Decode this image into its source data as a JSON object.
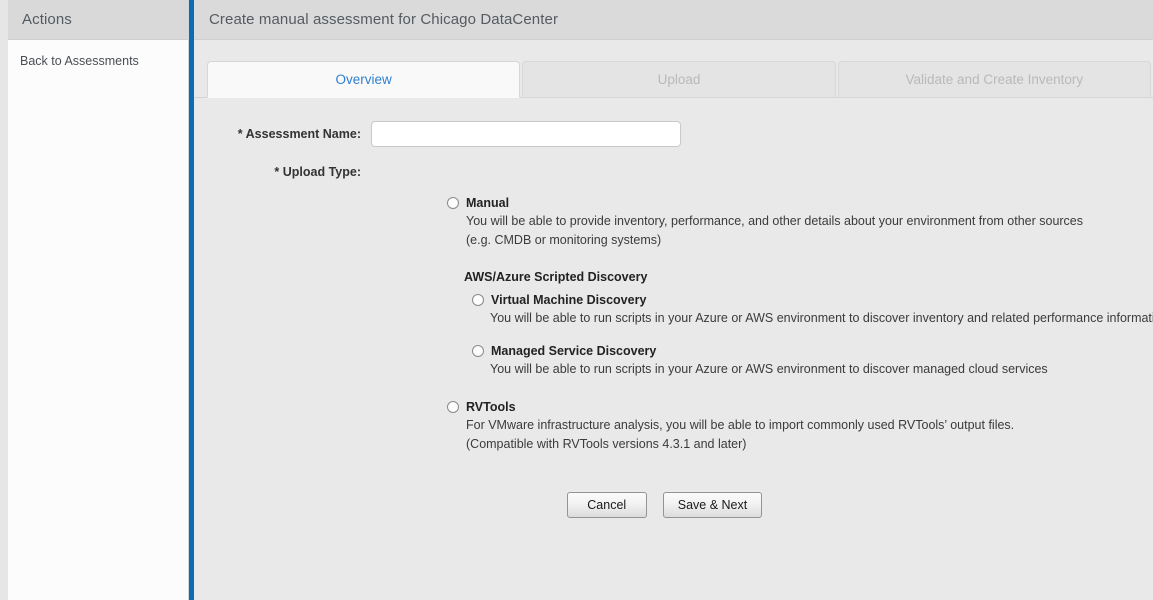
{
  "sidebar": {
    "header_title": "Actions",
    "links": [
      {
        "label": "Back to Assessments"
      }
    ]
  },
  "main": {
    "title": "Create manual assessment for Chicago DataCenter",
    "tabs": [
      {
        "label": "Overview",
        "state": "active"
      },
      {
        "label": "Upload",
        "state": "inactive"
      },
      {
        "label": "Validate and Create Inventory",
        "state": "inactive"
      }
    ],
    "form": {
      "required_marker": "*",
      "assessment_name_label": "Assessment Name:",
      "assessment_name_value": "",
      "assessment_name_placeholder": "",
      "upload_type_label": "Upload Type:",
      "options": [
        {
          "title": "Manual",
          "desc_line1": "You will be able to provide inventory, performance, and other details about your environment from other sources",
          "desc_line2": "(e.g. CMDB or monitoring systems)",
          "selected": false
        },
        {
          "title": "Virtual Machine Discovery",
          "desc_line1": "You will be able to run scripts in your Azure or AWS environment to discover inventory and related performance information for machine imports",
          "desc_line2": "",
          "selected": false
        },
        {
          "title": "Managed Service Discovery",
          "desc_line1": "You will be able to run scripts in your Azure or AWS environment to discover managed cloud services",
          "desc_line2": "",
          "selected": false
        },
        {
          "title": "RVTools",
          "desc_line1": "For VMware infrastructure analysis, you will be able to import commonly used RVTools’ output files.",
          "desc_line2": "(Compatible with RVTools versions 4.3.1 and later)",
          "selected": false
        }
      ],
      "group_heading": "AWS/Azure Scripted Discovery"
    },
    "buttons": {
      "cancel_label": "Cancel",
      "save_next_label": "Save & Next"
    }
  },
  "colors": {
    "accent_blue": "#0a6cb4",
    "tab_active_text": "#2f7fd0",
    "titlebar_bg": "#dadada",
    "content_bg": "#e9e9e9"
  }
}
